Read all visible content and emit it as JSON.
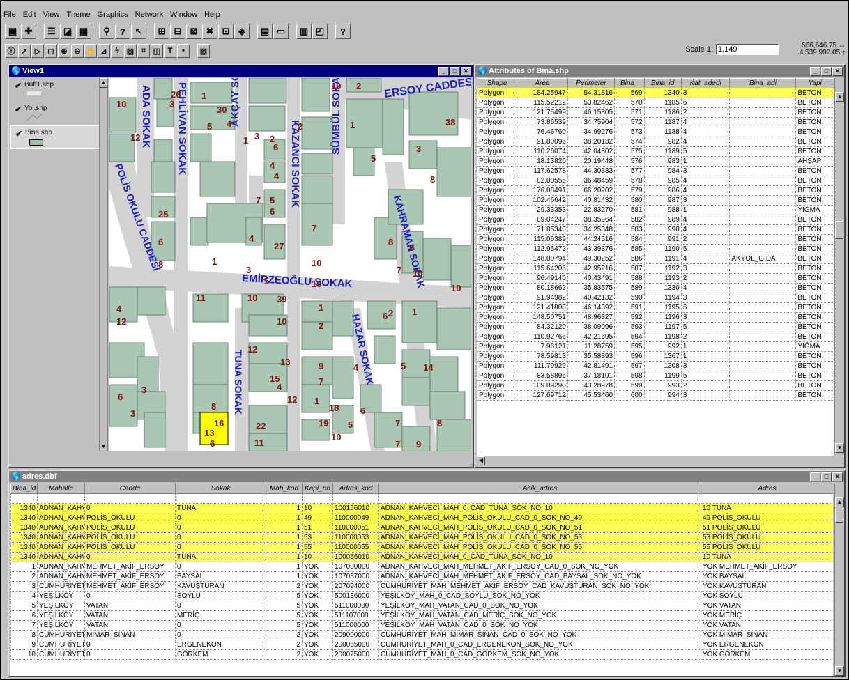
{
  "menu": [
    "File",
    "Edit",
    "View",
    "Theme",
    "Graphics",
    "Network",
    "Window",
    "Help"
  ],
  "scale": {
    "label": "Scale 1:",
    "value": "1,149"
  },
  "coords": {
    "x": "566,646.75",
    "y": "4,539,992.05"
  },
  "view": {
    "title": "View1",
    "layers": [
      {
        "name": "Buff1.shp"
      },
      {
        "name": "Yol.shp"
      },
      {
        "name": "Bina.shp"
      }
    ]
  },
  "map": {
    "streets": [
      "ERSOY CADDESİ",
      "ADA SOKAK",
      "PEHLİVAN SOKAK",
      "AKÇAY SOKAK",
      "KAZANCI SOKAK",
      "SÜMBÜL SOKAK",
      "POLİS OKULU CADDESİ",
      "KAHRAMAN SOKAK",
      "EMİRZEOĞLU SOKAK",
      "TUNA SOKAK",
      "HAZAR SOKAK"
    ],
    "numbers": [
      "26",
      "19",
      "2",
      "10",
      "3",
      "1",
      "30",
      "5",
      "4",
      "38",
      "12",
      "3",
      "2",
      "1",
      "2",
      "1",
      "6",
      "3",
      "4",
      "4",
      "5",
      "8",
      "5",
      "25",
      "7",
      "6",
      "6",
      "4",
      "27",
      "7",
      "10",
      "8",
      "8",
      "9",
      "1",
      "3",
      "5",
      "10",
      "7",
      "10",
      "10",
      "11",
      "10",
      "39",
      "1",
      "2",
      "4",
      "12",
      "10",
      "2",
      "6",
      "1",
      "12",
      "13",
      "9",
      "4",
      "5",
      "14",
      "15",
      "4",
      "7",
      "1",
      "6",
      "3",
      "12",
      "18",
      "6",
      "3",
      "8",
      "16",
      "22",
      "6",
      "11",
      "8",
      "19",
      "5",
      "10",
      "7",
      "18",
      "2",
      "13",
      "10",
      "7",
      "9",
      "20",
      "21",
      "11"
    ]
  },
  "attributes": {
    "title": "Attributes of Bina.shp",
    "columns": [
      "Shape",
      "Area",
      "Perimeter",
      "Bina_",
      "Bina_id",
      "Kat_adedi",
      "Bina_adi",
      "Yapi"
    ],
    "rows": [
      [
        "Polygon",
        "184.25947",
        "54.31816",
        "569",
        "1340",
        "3",
        "",
        "BETON"
      ],
      [
        "Polygon",
        "115.52212",
        "53.82462",
        "570",
        "1185",
        "6",
        "",
        "BETON"
      ],
      [
        "Polygon",
        "121.75499",
        "46.15805",
        "571",
        "1186",
        "2",
        "",
        "BETON"
      ],
      [
        "Polygon",
        "73.86539",
        "34.75904",
        "572",
        "1187",
        "4",
        "",
        "BETON"
      ],
      [
        "Polygon",
        "76.46760",
        "34.99276",
        "573",
        "1188",
        "4",
        "",
        "BETON"
      ],
      [
        "Polygon",
        "91.80096",
        "38.20132",
        "574",
        "982",
        "4",
        "",
        "BETON"
      ],
      [
        "Polygon",
        "110.26074",
        "42.04802",
        "575",
        "1189",
        "5",
        "",
        "BETON"
      ],
      [
        "Polygon",
        "18.13820",
        "20.19448",
        "576",
        "983",
        "1",
        "",
        "AHŞAP"
      ],
      [
        "Polygon",
        "117.62578",
        "44.30333",
        "577",
        "984",
        "3",
        "",
        "BETON"
      ],
      [
        "Polygon",
        "82.00555",
        "36.48459",
        "578",
        "985",
        "4",
        "",
        "BETON"
      ],
      [
        "Polygon",
        "176.08491",
        "66.20202",
        "579",
        "986",
        "4",
        "",
        "BETON"
      ],
      [
        "Polygon",
        "102.46642",
        "40.81432",
        "580",
        "987",
        "3",
        "",
        "BETON"
      ],
      [
        "Polygon",
        "29.33353",
        "22.83270",
        "581",
        "988",
        "1",
        "",
        "YIĞMA"
      ],
      [
        "Polygon",
        "89.04247",
        "38.35964",
        "582",
        "989",
        "4",
        "",
        "BETON"
      ],
      [
        "Polygon",
        "71.85340",
        "34.25348",
        "583",
        "990",
        "4",
        "",
        "BETON"
      ],
      [
        "Polygon",
        "115.06389",
        "44.24516",
        "584",
        "991",
        "2",
        "",
        "BETON"
      ],
      [
        "Polygon",
        "112.96472",
        "43.39376",
        "585",
        "1190",
        "5",
        "",
        "BETON"
      ],
      [
        "Polygon",
        "148.00794",
        "49.30252",
        "586",
        "1191",
        "4",
        "AKYOL_GIDA",
        "BETON"
      ],
      [
        "Polygon",
        "115.64206",
        "42.95216",
        "587",
        "1192",
        "3",
        "",
        "BETON"
      ],
      [
        "Polygon",
        "96.49140",
        "40.43491",
        "588",
        "1193",
        "2",
        "",
        "BETON"
      ],
      [
        "Polygon",
        "80.18662",
        "35.83575",
        "589",
        "1330",
        "4",
        "",
        "BETON"
      ],
      [
        "Polygon",
        "91.94982",
        "40.42132",
        "590",
        "1194",
        "3",
        "",
        "BETON"
      ],
      [
        "Polygon",
        "121.41800",
        "46.14392",
        "591",
        "1195",
        "6",
        "",
        "BETON"
      ],
      [
        "Polygon",
        "148.50751",
        "48.96327",
        "592",
        "1196",
        "3",
        "",
        "BETON"
      ],
      [
        "Polygon",
        "84.32120",
        "38.09096",
        "593",
        "1197",
        "5",
        "",
        "BETON"
      ],
      [
        "Polygon",
        "110.92766",
        "42.21695",
        "594",
        "1198",
        "2",
        "",
        "BETON"
      ],
      [
        "Polygon",
        "7.96121",
        "11.28759",
        "595",
        "992",
        "1",
        "",
        "YIĞMA"
      ],
      [
        "Polygon",
        "78.59813",
        "35.58893",
        "596",
        "1367",
        "1",
        "",
        "BETON"
      ],
      [
        "Polygon",
        "111.79929",
        "42.81491",
        "597",
        "1308",
        "3",
        "",
        "BETON"
      ],
      [
        "Polygon",
        "83.58896",
        "37.18101",
        "598",
        "1199",
        "5",
        "",
        "BETON"
      ],
      [
        "Polygon",
        "109.09290",
        "43.28978",
        "599",
        "993",
        "2",
        "",
        "BETON"
      ],
      [
        "Polygon",
        "127.69712",
        "45.53460",
        "600",
        "994",
        "3",
        "",
        "BETON"
      ]
    ]
  },
  "adres": {
    "title": "adres.dbf",
    "columns": [
      "Bina_id",
      "Mahalle",
      "Cadde",
      "Sokak",
      "Mah_kod",
      "Kapi_no",
      "Adres_kod",
      "Acik_adres",
      "Adres"
    ],
    "rows": [
      [
        "1340",
        "ADNAN_KAHVECİ",
        "0",
        "TUNA",
        "1",
        "10",
        "100156010",
        "ADNAN_KAHVECİ_MAH_0_CAD_TUNA_SOK_NO_10",
        "10 TUNA"
      ],
      [
        "1340",
        "ADNAN_KAHVECİ",
        "POLİS_OKULU",
        "0",
        "1",
        "49",
        "110000049",
        "ADNAN_KAHVECİ_MAH_POLİS_OKULU_CAD_0_SOK_NO_49",
        "49 POLİS_OKULU"
      ],
      [
        "1340",
        "ADNAN_KAHVECİ",
        "POLİS_OKULU",
        "0",
        "1",
        "51",
        "110000051",
        "ADNAN_KAHVECİ_MAH_POLİS_OKULU_CAD_0_SOK_NO_51",
        "51 POLİS_OKULU"
      ],
      [
        "1340",
        "ADNAN_KAHVECİ",
        "POLİS_OKULU",
        "0",
        "1",
        "53",
        "110000053",
        "ADNAN_KAHVECİ_MAH_POLİS_OKULU_CAD_0_SOK_NO_53",
        "53 POLİS_OKULU"
      ],
      [
        "1340",
        "ADNAN_KAHVECİ",
        "POLİS_OKULU",
        "0",
        "1",
        "55",
        "110000055",
        "ADNAN_KAHVECİ_MAH_POLİS_OKULU_CAD_0_SOK_NO_55",
        "55 POLİS_OKULU"
      ],
      [
        "1340",
        "ADNAN_KAHVECİ",
        "0",
        "TUNA",
        "1",
        "10",
        "100056010",
        "ADNAN_KAHVECİ_MAH_0_CAD_TUNA_SOK_NO_10",
        "10 TUNA"
      ],
      [
        "1",
        "ADNAN_KAHVECİ",
        "MEHMET_AKİF_ERSOY",
        "0",
        "1",
        "YOK",
        "107000000",
        "ADNAN_KAHVECİ_MAH_MEHMET_AKİF_ERSOY_CAD_0_SOK_NO_YOK",
        "YOK MEHMET_AKİF_ERSOY"
      ],
      [
        "2",
        "ADNAN_KAHVECİ",
        "MEHMET_AKİF_ERSOY",
        "BAYSAL",
        "1",
        "YOK",
        "107037000",
        "ADNAN_KAHVECİ_MAH_MEHMET_AKİF_ERSOY_CAD_BAYSAL_SOK_NO_YOK",
        "YOK BAYSAL"
      ],
      [
        "3",
        "CUMHURİYET",
        "MEHMET_AKİF_ERSOY",
        "KAVUŞTURAN",
        "2",
        "YOK",
        "207094000",
        "CUMHURİYET_MAH_MEHMET_AKİF_ERSOY_CAD_KAVUŞTURAN_SOK_NO_YOK",
        "YOK KAVUŞTURAN"
      ],
      [
        "4",
        "YEŞİLKÖY",
        "0",
        "SOYLU",
        "5",
        "YOK",
        "500136000",
        "YEŞİLKÖY_MAH_0_CAD_SOYLU_SOK_NO_YOK",
        "YOK SOYLU"
      ],
      [
        "5",
        "YEŞİLKÖY",
        "VATAN",
        "0",
        "5",
        "YOK",
        "511000000",
        "YEŞİLKÖY_MAH_VATAN_CAD_0_SOK_NO_YOK",
        "YOK VATAN"
      ],
      [
        "6",
        "YEŞİLKÖY",
        "VATAN",
        "MERİÇ",
        "5",
        "YOK",
        "511107000",
        "YEŞİLKÖY_MAH_VATAN_CAD_MERİÇ_SOK_NO_YOK",
        "YOK MERİÇ"
      ],
      [
        "7",
        "YEŞİLKÖY",
        "VATAN",
        "0",
        "5",
        "YOK",
        "511000000",
        "YEŞİLKÖY_MAH_VATAN_CAD_0_SOK_NO_YOK",
        "YOK VATAN"
      ],
      [
        "8",
        "CUMHURİYET",
        "MİMAR_SİNAN",
        "0",
        "2",
        "YOK",
        "209000000",
        "CUMHURİYET_MAH_MİMAR_SİNAN_CAD_0_SOK_NO_YOK",
        "YOK MİMAR_SİNAN"
      ],
      [
        "9",
        "CUMHURİYET",
        "0",
        "ERGENEKON",
        "2",
        "YOK",
        "200065000",
        "CUMHURİYET_MAH_0_CAD_ERGENEKON_SOK_NO_YOK",
        "YOK ERGENEKON"
      ],
      [
        "10",
        "CUMHURİYET",
        "0",
        "GÖRKEM",
        "2",
        "YOK",
        "200075000",
        "CUMHURİYET_MAH_0_CAD_GÖRKEM_SOK_NO_YOK",
        "YOK GÖRKEM"
      ]
    ]
  }
}
